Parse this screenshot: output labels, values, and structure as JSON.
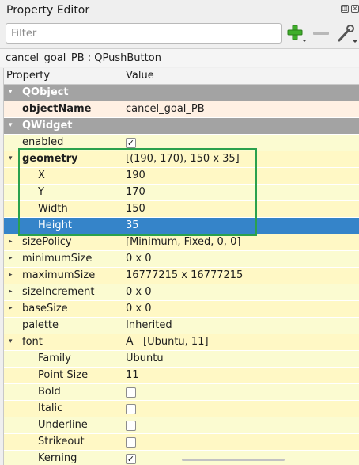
{
  "window": {
    "title": "Property Editor"
  },
  "toolbar": {
    "filter_placeholder": "Filter",
    "add_icon": "plus-icon",
    "remove_icon": "minus-icon",
    "configure_icon": "wrench-icon"
  },
  "object": {
    "label": "cancel_goal_PB : QPushButton"
  },
  "table": {
    "header": {
      "property": "Property",
      "value": "Value"
    },
    "rows": [
      {
        "name": "QObject",
        "value": "",
        "kind": "category",
        "expander": "▾"
      },
      {
        "name": "objectName",
        "value": "cancel_goal_PB",
        "kind": "object",
        "bold": true
      },
      {
        "name": "QWidget",
        "value": "",
        "kind": "category",
        "expander": "▾"
      },
      {
        "name": "enabled",
        "value": "✓",
        "kind": "y2",
        "checkbox": true
      },
      {
        "name": "geometry",
        "value": "[(190, 170), 150 x 35]",
        "kind": "y1",
        "bold": true,
        "expander": "▾"
      },
      {
        "name": "X",
        "value": "190",
        "kind": "y1",
        "indent": 2
      },
      {
        "name": "Y",
        "value": "170",
        "kind": "y2",
        "indent": 2
      },
      {
        "name": "Width",
        "value": "150",
        "kind": "y1",
        "indent": 2
      },
      {
        "name": "Height",
        "value": "35",
        "kind": "selected",
        "indent": 2
      },
      {
        "name": "sizePolicy",
        "value": "[Minimum, Fixed, 0, 0]",
        "kind": "y1",
        "expander": "▸"
      },
      {
        "name": "minimumSize",
        "value": "0 x 0",
        "kind": "y2",
        "expander": "▸"
      },
      {
        "name": "maximumSize",
        "value": "16777215 x 16777215",
        "kind": "y1",
        "expander": "▸"
      },
      {
        "name": "sizeIncrement",
        "value": "0 x 0",
        "kind": "y2",
        "expander": "▸"
      },
      {
        "name": "baseSize",
        "value": "0 x 0",
        "kind": "y1",
        "expander": "▸"
      },
      {
        "name": "palette",
        "value": "Inherited",
        "kind": "y2"
      },
      {
        "name": "font",
        "value": "[Ubuntu, 11]",
        "kind": "y1",
        "expander": "▾",
        "font_glyph": "A"
      },
      {
        "name": "Family",
        "value": "Ubuntu",
        "kind": "y2",
        "indent": 2
      },
      {
        "name": "Point Size",
        "value": "11",
        "kind": "y1",
        "indent": 2
      },
      {
        "name": "Bold",
        "value": "",
        "kind": "y2",
        "indent": 2,
        "checkbox": true
      },
      {
        "name": "Italic",
        "value": "",
        "kind": "y1",
        "indent": 2,
        "checkbox": true
      },
      {
        "name": "Underline",
        "value": "",
        "kind": "y2",
        "indent": 2,
        "checkbox": true
      },
      {
        "name": "Strikeout",
        "value": "",
        "kind": "y1",
        "indent": 2,
        "checkbox": true
      },
      {
        "name": "Kerning",
        "value": "✓",
        "kind": "y2",
        "indent": 2,
        "checkbox": true
      }
    ]
  },
  "colors": {
    "category": "#a3a3a3",
    "selection": "#3584c9",
    "row_yellow": "#fff8c5",
    "row_yellow_alt": "#fbfbd1",
    "object_row": "#fff0e3",
    "highlight_box": "#2aa14d"
  }
}
